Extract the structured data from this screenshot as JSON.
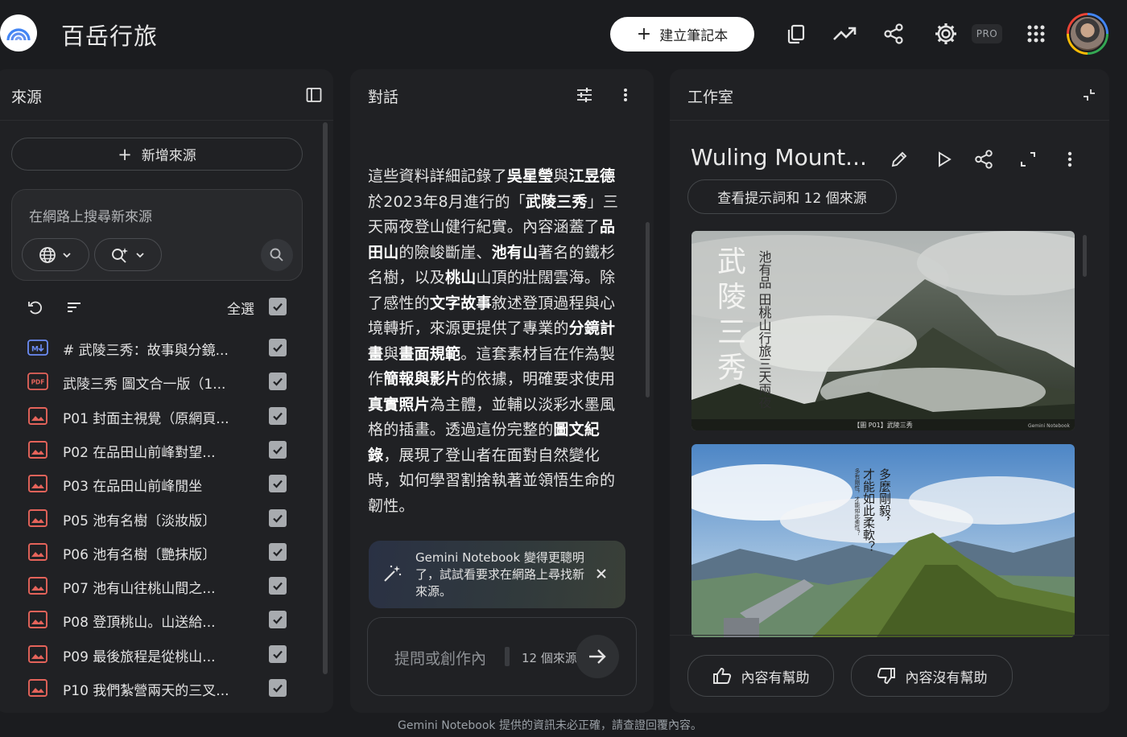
{
  "header": {
    "app_title": "百岳行旅",
    "create_notebook_label": "建立筆記本",
    "pro_badge": "PRO",
    "icons": [
      "copy-icon",
      "trending-icon",
      "share-icon",
      "settings-icon",
      "apps-grid-icon"
    ]
  },
  "sources": {
    "title": "來源",
    "add_source_label": "新增來源",
    "search_placeholder": "在網路上搜尋新來源",
    "select_all_label": "全選",
    "items": [
      {
        "label": "# 武陵三秀：故事與分鏡...",
        "type": "markdown"
      },
      {
        "label": "武陵三秀 圖文合一版（1...",
        "type": "pdf"
      },
      {
        "label": "P01 封面主視覺（原網頁...",
        "type": "image"
      },
      {
        "label": "P02 在品田山前峰對望...",
        "type": "image"
      },
      {
        "label": "P03 在品田山前峰閒坐",
        "type": "image"
      },
      {
        "label": "P05 池有名樹〔淡妝版〕",
        "type": "image"
      },
      {
        "label": "P06 池有名樹〔艷抹版〕",
        "type": "image"
      },
      {
        "label": "P07 池有山往桃山間之...",
        "type": "image"
      },
      {
        "label": "P08 登頂桃山。山送給...",
        "type": "image"
      },
      {
        "label": "P09 最後旅程是從桃山...",
        "type": "image"
      },
      {
        "label": "P10 我們紮營兩天的三叉...",
        "type": "image"
      }
    ]
  },
  "chat": {
    "title": "對話",
    "message_segments": [
      {
        "t": "這些資料詳細記錄了",
        "b": false
      },
      {
        "t": "吳星瑩",
        "b": true
      },
      {
        "t": "與",
        "b": false
      },
      {
        "t": "江昱德",
        "b": true
      },
      {
        "t": "於2023年8月進行的「",
        "b": false
      },
      {
        "t": "武陵三秀",
        "b": true
      },
      {
        "t": "」三天兩夜登山健行紀實。內容涵蓋了",
        "b": false
      },
      {
        "t": "品田山",
        "b": true
      },
      {
        "t": "的險峻斷崖、",
        "b": false
      },
      {
        "t": "池有山",
        "b": true
      },
      {
        "t": "著名的鐵杉名樹，以及",
        "b": false
      },
      {
        "t": "桃山",
        "b": true
      },
      {
        "t": "山頂的壯闊雲海。除了感性的",
        "b": false
      },
      {
        "t": "文字故事",
        "b": true
      },
      {
        "t": "敘述登頂過程與心境轉折，來源更提供了專業的",
        "b": false
      },
      {
        "t": "分鏡計畫",
        "b": true
      },
      {
        "t": "與",
        "b": false
      },
      {
        "t": "畫面規範",
        "b": true
      },
      {
        "t": "。這套素材旨在作為製作",
        "b": false
      },
      {
        "t": "簡報與影片",
        "b": true
      },
      {
        "t": "的依據，明確要求使用",
        "b": false
      },
      {
        "t": "真實照片",
        "b": true
      },
      {
        "t": "為主體，並輔以淡彩水墨風格的插畫。透過這份完整的",
        "b": false
      },
      {
        "t": "圖文紀錄",
        "b": true
      },
      {
        "t": "，展現了登山者在面對自然變化時，如何學習割捨執著並領悟生命的韌性。",
        "b": false
      }
    ],
    "toast_text": "Gemini Notebook 變得更聰明了，試試看要求在網路上尋找新來源。",
    "input_placeholder": "提問或創作內",
    "source_count": "12 個來源"
  },
  "studio": {
    "title": "工作室",
    "note_title": "Wuling Mount...",
    "prompt_chip_label": "查看提示詞和 12 個來源",
    "image1": {
      "big_title": "武陵三秀",
      "side_text": "池有品 田桃山行旅三天兩夜",
      "caption": "【圖 P01】武陵三秀",
      "watermark": "Gemini Notebook"
    },
    "image2": {
      "poem_line1": "多麼剛毅，",
      "poem_line2": "才能如此柔軟？",
      "poem_small": "多有剛性，才能如此柔性？"
    },
    "helpful_label": "內容有幫助",
    "not_helpful_label": "內容沒有幫助"
  },
  "footer_note": "Gemini Notebook 提供的資訊未必正確，請查證回覆內容。"
}
